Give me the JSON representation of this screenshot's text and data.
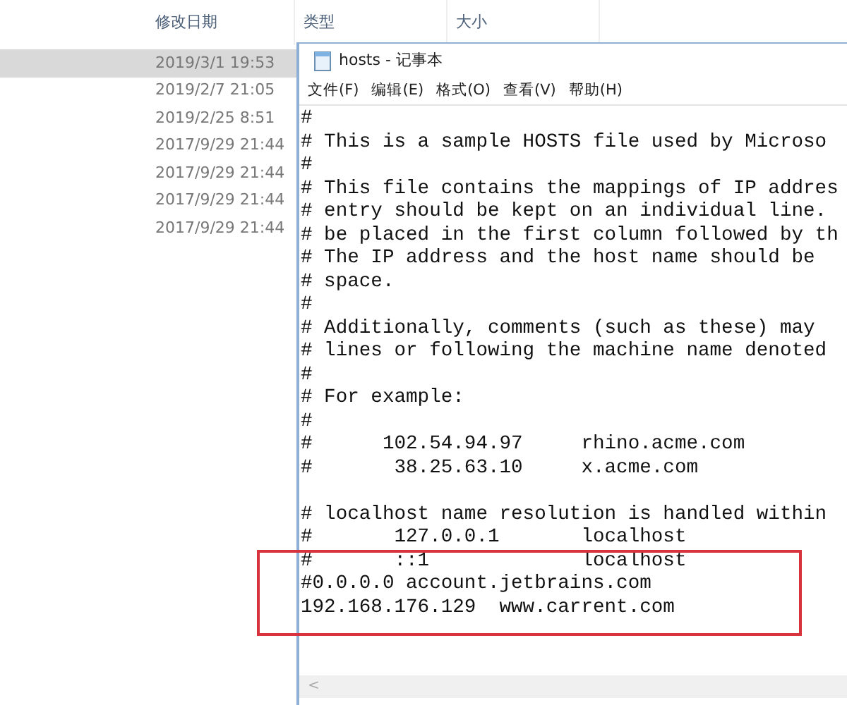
{
  "explorer": {
    "columns": [
      {
        "label": "修改日期"
      },
      {
        "label": "类型"
      },
      {
        "label": "大小"
      }
    ],
    "rows": [
      {
        "modified": "2019/3/1 19:53",
        "selected": true
      },
      {
        "modified": "2019/2/7 21:05",
        "selected": false
      },
      {
        "modified": "2019/2/25 8:51",
        "selected": false
      },
      {
        "modified": "2017/9/29 21:44",
        "selected": false
      },
      {
        "modified": "2017/9/29 21:44",
        "selected": false
      },
      {
        "modified": "2017/9/29 21:44",
        "selected": false
      },
      {
        "modified": "2017/9/29 21:44",
        "selected": false
      }
    ]
  },
  "notepad": {
    "title": "hosts - 记事本",
    "menu": [
      "文件(F)",
      "编辑(E)",
      "格式(O)",
      "查看(V)",
      "帮助(H)"
    ],
    "lines": [
      {
        "kind": "text",
        "text": "#"
      },
      {
        "kind": "text",
        "text": "# This is a sample HOSTS file used by Microso"
      },
      {
        "kind": "text",
        "text": "#"
      },
      {
        "kind": "text",
        "text": "# This file contains the mappings of IP addres"
      },
      {
        "kind": "text",
        "text": "# entry should be kept on an individual line."
      },
      {
        "kind": "text",
        "text": "# be placed in the first column followed by th"
      },
      {
        "kind": "text",
        "text": "# The IP address and the host name should be"
      },
      {
        "kind": "text",
        "text": "# space."
      },
      {
        "kind": "text",
        "text": "#"
      },
      {
        "kind": "text",
        "text": "# Additionally, comments (such as these) may"
      },
      {
        "kind": "text",
        "text": "# lines or following the machine name denoted"
      },
      {
        "kind": "text",
        "text": "#"
      },
      {
        "kind": "text",
        "text": "# For example:"
      },
      {
        "kind": "text",
        "text": "#"
      },
      {
        "kind": "text",
        "text": "#      102.54.94.97     rhino.acme.com"
      },
      {
        "kind": "text",
        "text": "#       38.25.63.10     x.acme.com"
      },
      {
        "kind": "blank"
      },
      {
        "kind": "text",
        "text": "# localhost name resolution is handled within"
      },
      {
        "kind": "text",
        "text": "#       127.0.0.1       localhost"
      },
      {
        "kind": "text",
        "text": "#       ::1             localhost"
      },
      {
        "kind": "text",
        "text": "#0.0.0.0 account.jetbrains.com"
      },
      {
        "kind": "text",
        "text": "192.168.176.129  www.carrent.com"
      }
    ],
    "scroll_left": "<"
  }
}
